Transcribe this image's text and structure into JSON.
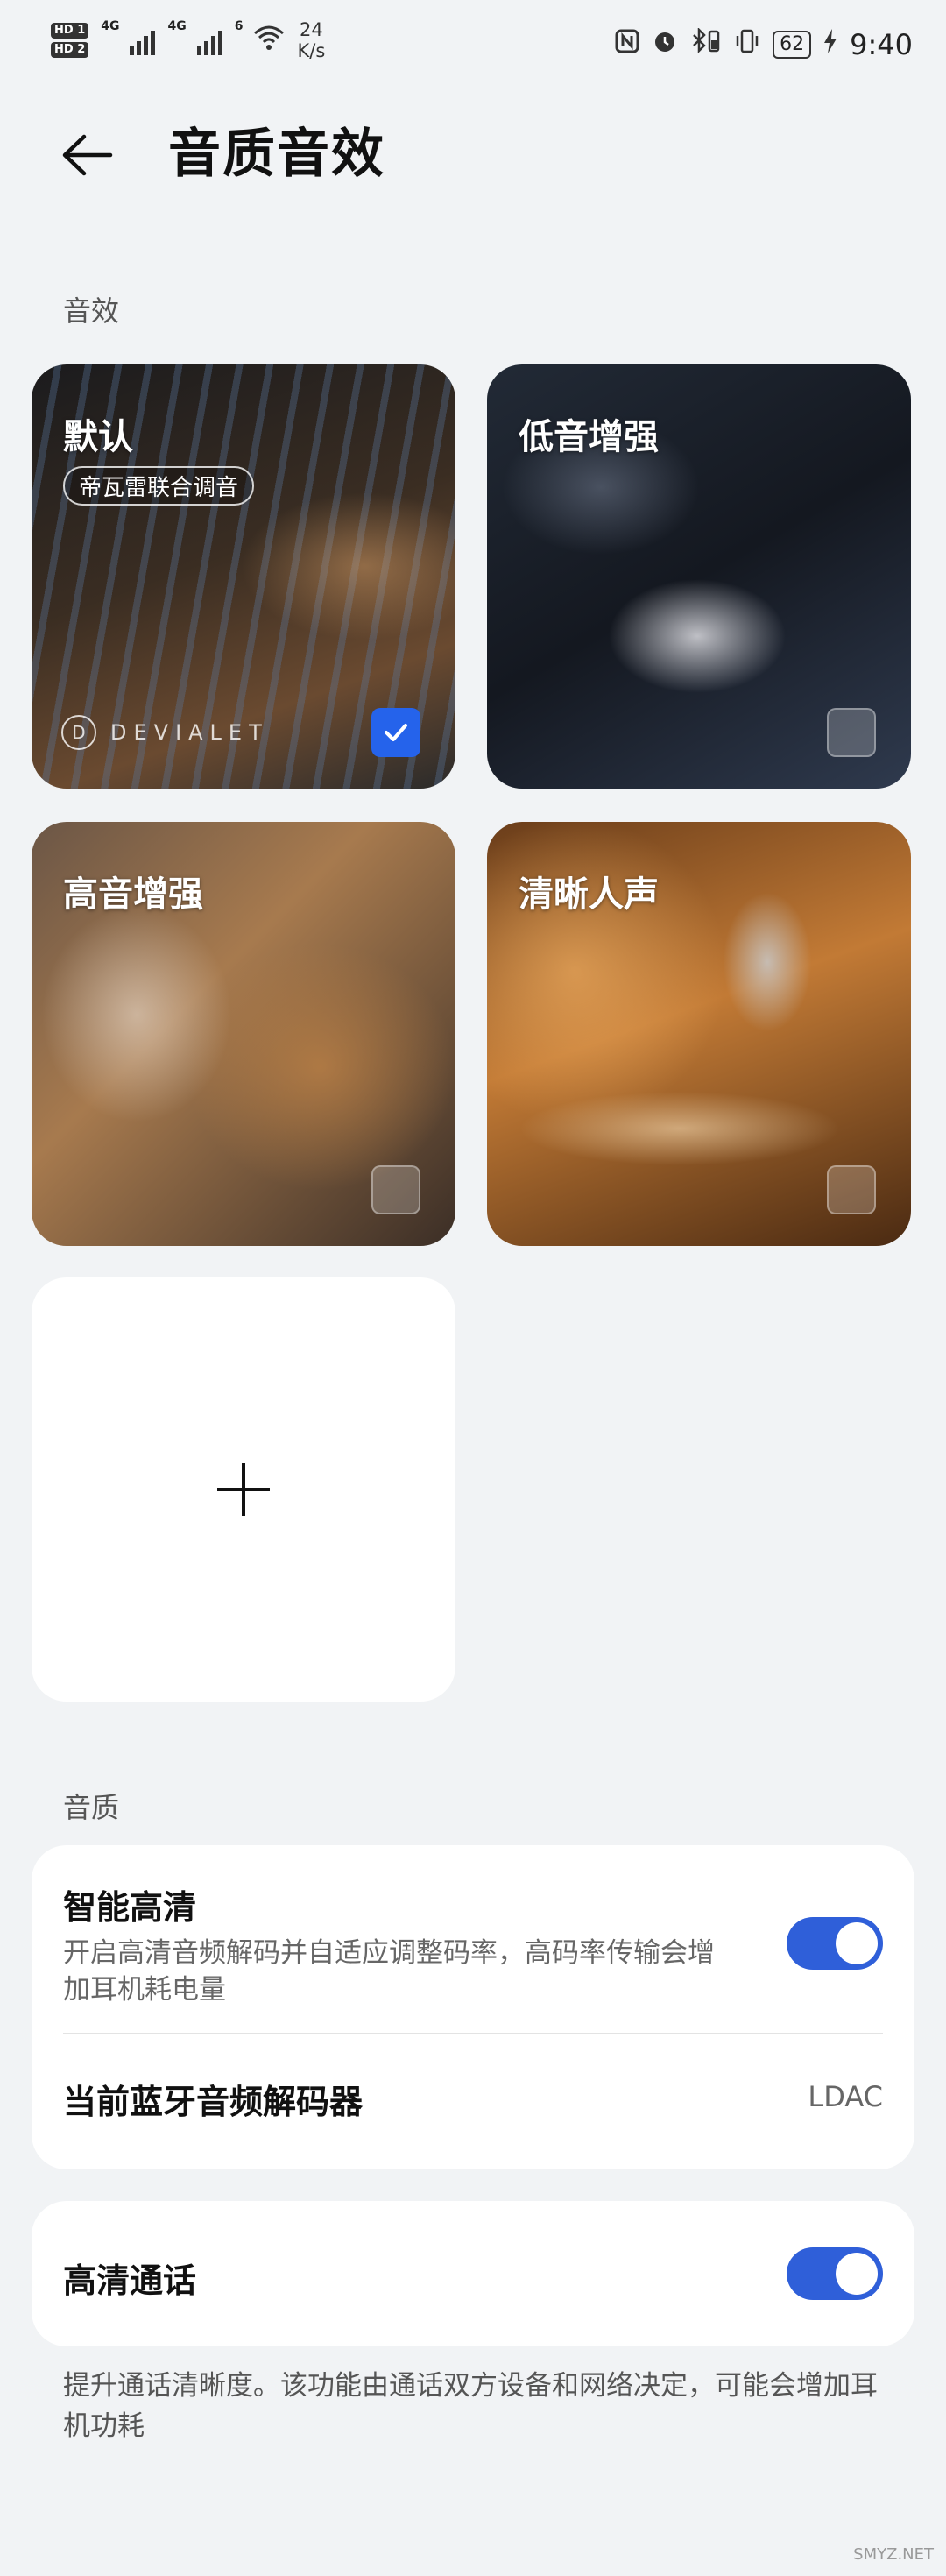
{
  "status_bar": {
    "hd1": "HD 1",
    "hd2": "HD 2",
    "net1": "4G",
    "net2": "4G",
    "wifi_gen": "6",
    "speed_value": "24",
    "speed_unit": "K/s",
    "battery": "62",
    "time": "9:40"
  },
  "header": {
    "title": "音质音效"
  },
  "effects": {
    "section_label": "音效",
    "cards": [
      {
        "label": "默认",
        "badge": "帝瓦雷联合调音",
        "brand": "DEVIALET",
        "selected": true
      },
      {
        "label": "低音增强",
        "selected": false
      },
      {
        "label": "高音增强",
        "selected": false
      },
      {
        "label": "清晰人声",
        "selected": false
      }
    ]
  },
  "quality": {
    "section_label": "音质",
    "smart_hd": {
      "title": "智能高清",
      "description": "开启高清音频解码并自适应调整码率，高码率传输会增加耳机耗电量",
      "enabled": true
    },
    "codec": {
      "label": "当前蓝牙音频解码器",
      "value": "LDAC"
    },
    "hd_call": {
      "title": "高清通话",
      "enabled": true
    },
    "footnote": "提升通话清晰度。该功能由通话双方设备和网络决定，可能会增加耳机功耗"
  },
  "watermark": "SMYZ.NET",
  "colors": {
    "accent": "#2f5fd9",
    "background": "#f1f3f5",
    "card": "#ffffff"
  }
}
